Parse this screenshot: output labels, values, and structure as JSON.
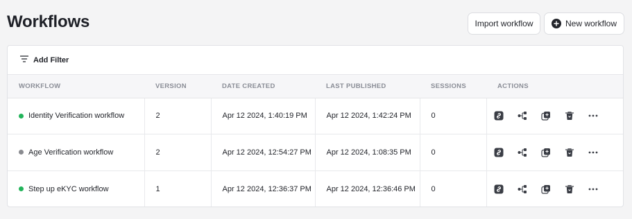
{
  "header": {
    "title": "Workflows",
    "import_label": "Import workflow",
    "new_label": "New workflow"
  },
  "filter": {
    "label": "Add Filter"
  },
  "columns": [
    "WORKFLOW",
    "VERSION",
    "DATE CREATED",
    "LAST PUBLISHED",
    "SESSIONS",
    "ACTIONS"
  ],
  "rows": [
    {
      "name": "Identity Verification workflow",
      "status_color": "#22b45a",
      "version": "2",
      "date_created": "Apr 12 2024, 1:40:19 PM",
      "last_published": "Apr 12 2024, 1:42:24 PM",
      "sessions": "0"
    },
    {
      "name": "Age Verification workflow",
      "status_color": "#8a8b90",
      "version": "2",
      "date_created": "Apr 12 2024, 12:54:27 PM",
      "last_published": "Apr 12 2024, 1:08:35 PM",
      "sessions": "0"
    },
    {
      "name": "Step up eKYC workflow",
      "status_color": "#22b45a",
      "version": "1",
      "date_created": "Apr 12 2024, 12:36:37 PM",
      "last_published": "Apr 12 2024, 12:36:46 PM",
      "sessions": "0"
    }
  ],
  "actions": [
    "link-icon",
    "flow-icon",
    "duplicate-icon",
    "trash-icon",
    "more-icon"
  ]
}
